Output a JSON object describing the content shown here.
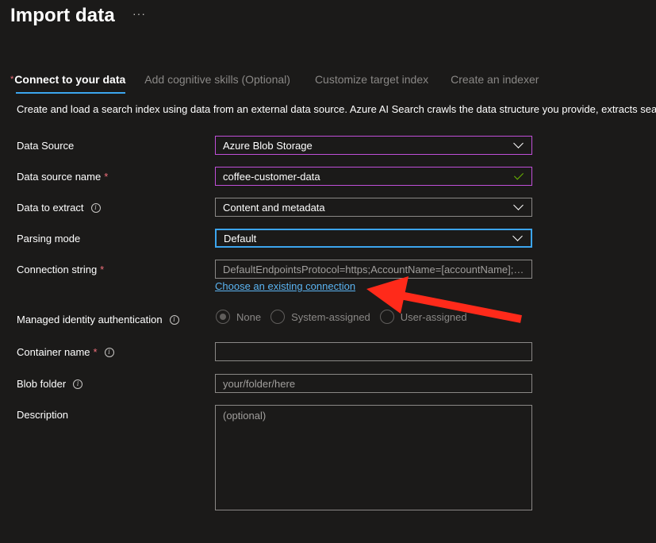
{
  "header": {
    "title": "Import data",
    "more_label": "···"
  },
  "tabs": [
    {
      "label": "Connect to your data",
      "active": true,
      "required_mark": "*"
    },
    {
      "label": "Add cognitive skills (Optional)",
      "active": false
    },
    {
      "label": "Customize target index",
      "active": false
    },
    {
      "label": "Create an indexer",
      "active": false
    }
  ],
  "intro": "Create and load a search index using data from an external data source. Azure AI Search crawls the data structure you provide, extracts searchable content",
  "form": {
    "data_source": {
      "label": "Data Source",
      "value": "Azure Blob Storage"
    },
    "data_source_name": {
      "label": "Data source name",
      "required": "*",
      "value": "coffee-customer-data"
    },
    "data_to_extract": {
      "label": "Data to extract",
      "value": "Content and metadata"
    },
    "parsing_mode": {
      "label": "Parsing mode",
      "value": "Default"
    },
    "connection_string": {
      "label": "Connection string",
      "required": "*",
      "value": "DefaultEndpointsProtocol=https;AccountName=[accountName];AccountKey=[accountKey]",
      "link": "Choose an existing connection"
    },
    "managed_identity": {
      "label": "Managed identity authentication",
      "options": [
        "None",
        "System-assigned",
        "User-assigned"
      ],
      "selected": "None"
    },
    "container_name": {
      "label": "Container name",
      "required": "*",
      "value": ""
    },
    "blob_folder": {
      "label": "Blob folder",
      "placeholder": "your/folder/here"
    },
    "description": {
      "label": "Description",
      "placeholder": "(optional)"
    }
  },
  "colors": {
    "accent": "#3ca5ee",
    "required": "#f1707b",
    "annotation_arrow": "#ff2a1a",
    "focus_purple": "#c04fd8"
  },
  "icons": [
    "info-icon",
    "chevron-down-icon",
    "check-icon",
    "annotation-arrow"
  ]
}
